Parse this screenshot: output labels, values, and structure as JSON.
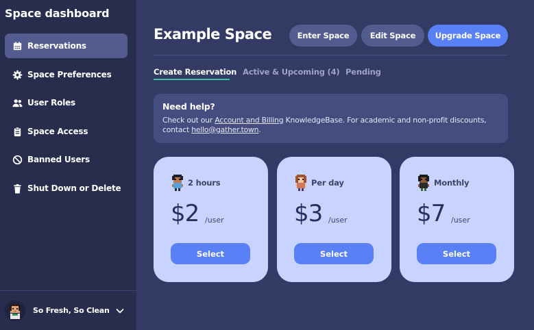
{
  "sidebar": {
    "title": "Space dashboard",
    "items": [
      {
        "label": "Reservations",
        "icon": "calendar-icon"
      },
      {
        "label": "Space Preferences",
        "icon": "gear-icon"
      },
      {
        "label": "User Roles",
        "icon": "users-icon"
      },
      {
        "label": "Space Access",
        "icon": "clipboard-icon"
      },
      {
        "label": "Banned Users",
        "icon": "ban-icon"
      },
      {
        "label": "Shut Down or Delete",
        "icon": "trash-icon"
      }
    ],
    "user": {
      "name": "So Fresh, So Clean"
    }
  },
  "header": {
    "title": "Example Space",
    "enter_label": "Enter Space",
    "edit_label": "Edit Space",
    "upgrade_label": "Upgrade Space"
  },
  "tabs": [
    {
      "label": "Create Reservation"
    },
    {
      "label": "Active & Upcoming (4)"
    },
    {
      "label": "Pending"
    }
  ],
  "help": {
    "title": "Need help?",
    "text_1": "Check out our ",
    "link_1": "Account and Billing",
    "text_2": " KnowledgeBase. For academic and non-profit discounts, contact ",
    "link_2": "hello@gather.town",
    "text_3": "."
  },
  "plans": [
    {
      "label": "2 hours",
      "price": "$2",
      "unit": "/user",
      "select_label": "Select"
    },
    {
      "label": "Per day",
      "price": "$3",
      "unit": "/user",
      "select_label": "Select"
    },
    {
      "label": "Monthly",
      "price": "$7",
      "unit": "/user",
      "select_label": "Select"
    }
  ],
  "colors": {
    "background": "#333a64",
    "sidebar": "#282d4e",
    "primary": "#5a80f5",
    "secondary": "#545c8f",
    "card": "#c8d4ff",
    "tab_accent": "#3dc3a5"
  }
}
